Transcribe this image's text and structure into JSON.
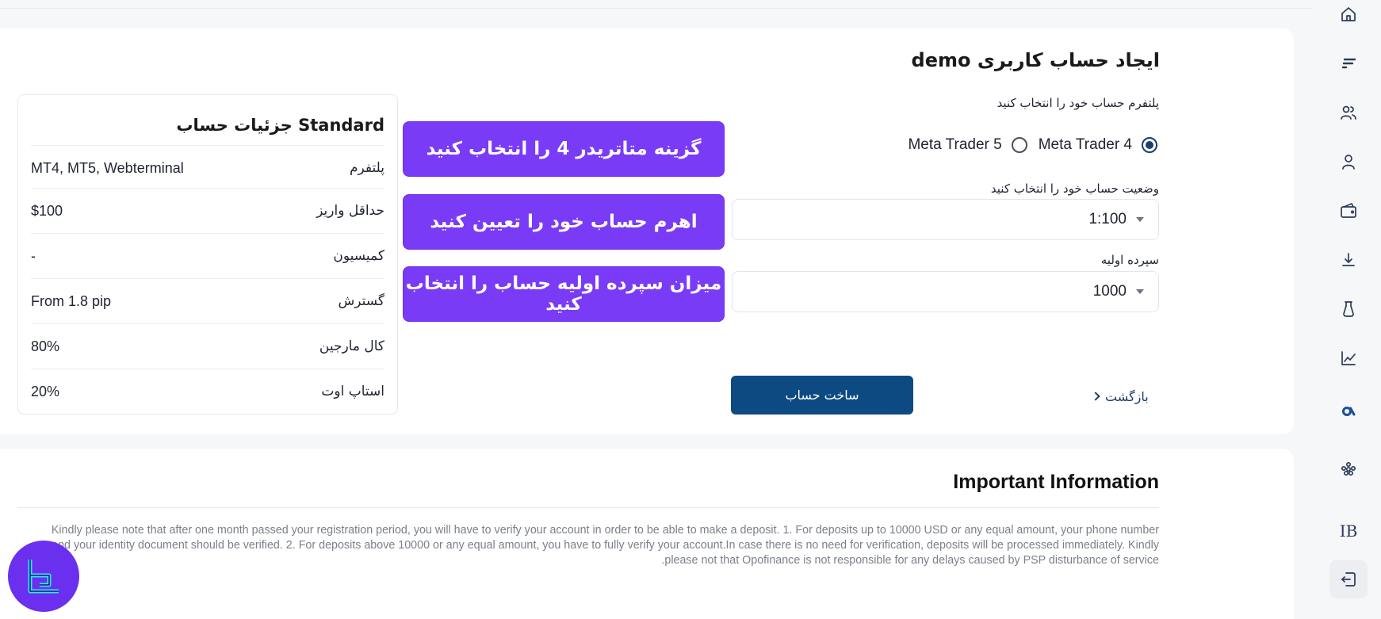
{
  "page": {
    "title": "ایجاد حساب کاربری demo",
    "platform_label": "پلتفرم حساب خود را انتخاب کنید",
    "platform_options": [
      {
        "label": "Meta Trader 4",
        "selected": true
      },
      {
        "label": "Meta Trader 5",
        "selected": false
      }
    ],
    "leverage_label": "وضعیت حساب خود را انتخاب کنید",
    "leverage_value": "1:100",
    "deposit_label": "سپرده اولیه",
    "deposit_value": "1000",
    "create_button": "ساخت حساب",
    "back_link": "بازگشت"
  },
  "annotations": [
    "گزینه متاتریدر 4 را انتخاب کنید",
    "اهرم حساب خود را تعیین کنید",
    "میزان سپرده اولیه حساب را انتخاب کنید"
  ],
  "details": {
    "title": "Standard جزئیات حساب",
    "rows": [
      {
        "key": "پلتفرم",
        "value": "MT4, MT5, Webterminal"
      },
      {
        "key": "حداقل واریز",
        "value": "$100"
      },
      {
        "key": "کمیسیون",
        "value": "-"
      },
      {
        "key": "گسترش",
        "value": "From 1.8 pip"
      },
      {
        "key": "کال مارجین",
        "value": "80%"
      },
      {
        "key": "استاپ اوت",
        "value": "20%"
      }
    ]
  },
  "info": {
    "title": "Important Information",
    "text": "Kindly please note that after one month passed your registration period, you will have to verify your account in order to be able to make a deposit. 1. For deposits up to 10000 USD or any equal amount, your phone number and your identity document should be verified. 2. For deposits above 10000 or any equal amount, you have to fully verify your account.In case there is no need for verification, deposits will be processed immediately. Kindly please not that Opofinance is not responsible for any delays caused by PSP disturbance of service."
  },
  "sidebar": {
    "items": [
      "home-icon",
      "brand-icon",
      "users-icon",
      "user-icon",
      "wallet-icon",
      "download-icon",
      "flask-icon",
      "chart-icon",
      "a-logo-icon",
      "apps-icon",
      "ib-icon",
      "logout-icon"
    ],
    "ib_label": "IB"
  },
  "colors": {
    "primary": "#0d4a82",
    "annotation": "#7a3bf7",
    "nav_icon": "#2d3a56"
  }
}
